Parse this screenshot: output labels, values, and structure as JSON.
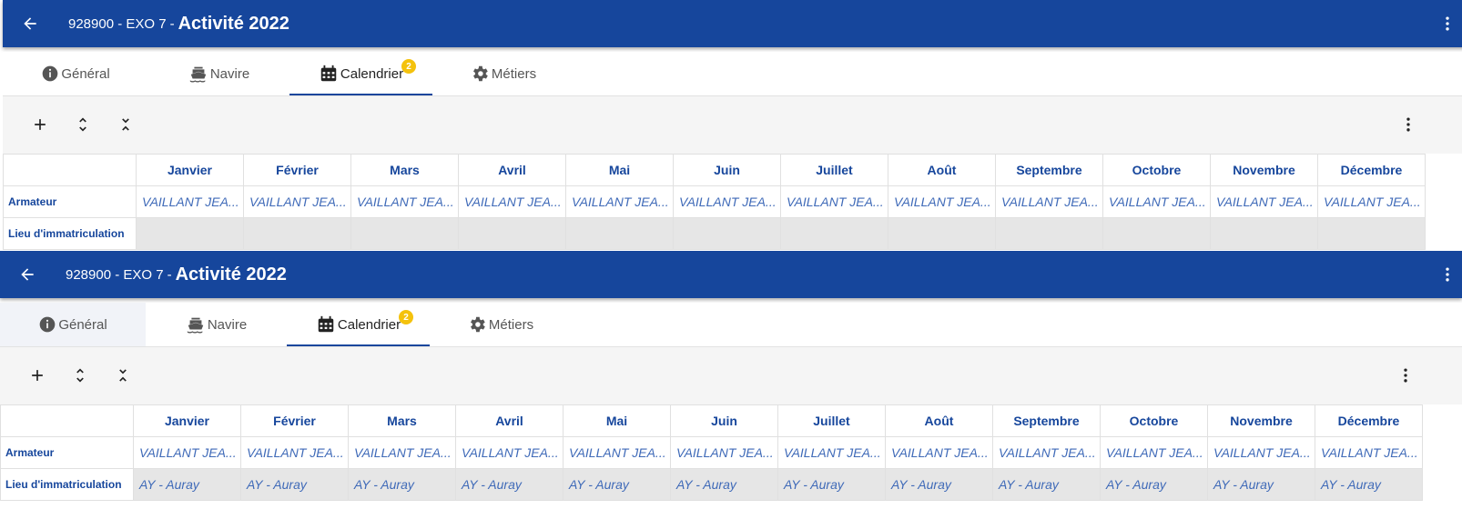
{
  "screens": [
    {
      "header": {
        "code": "928900 - EXO 7",
        "separator": "-",
        "title": "Activité 2022"
      },
      "tabs": [
        {
          "label": "Général"
        },
        {
          "label": "Navire"
        },
        {
          "label": "Calendrier",
          "badge": "2"
        },
        {
          "label": "Métiers"
        }
      ],
      "grid": {
        "months": [
          "Janvier",
          "Février",
          "Mars",
          "Avril",
          "Mai",
          "Juin",
          "Juillet",
          "Août",
          "Septembre",
          "Octobre",
          "Novembre",
          "Décembre"
        ],
        "rows": [
          {
            "label": "Armateur",
            "values": [
              "VAILLANT JEA...",
              "VAILLANT JEA...",
              "VAILLANT JEA...",
              "VAILLANT JEA...",
              "VAILLANT JEA...",
              "VAILLANT JEA...",
              "VAILLANT JEA...",
              "VAILLANT JEA...",
              "VAILLANT JEA...",
              "VAILLANT JEA...",
              "VAILLANT JEA...",
              "VAILLANT JEA..."
            ]
          },
          {
            "label": "Lieu d'immatriculation",
            "values": [
              "",
              "",
              "",
              "",
              "",
              "",
              "",
              "",
              "",
              "",
              "",
              ""
            ]
          }
        ]
      }
    },
    {
      "header": {
        "code": "928900 - EXO 7",
        "separator": "-",
        "title": "Activité 2022"
      },
      "tabs": [
        {
          "label": "Général"
        },
        {
          "label": "Navire"
        },
        {
          "label": "Calendrier",
          "badge": "2"
        },
        {
          "label": "Métiers"
        }
      ],
      "grid": {
        "months": [
          "Janvier",
          "Février",
          "Mars",
          "Avril",
          "Mai",
          "Juin",
          "Juillet",
          "Août",
          "Septembre",
          "Octobre",
          "Novembre",
          "Décembre"
        ],
        "rows": [
          {
            "label": "Armateur",
            "values": [
              "VAILLANT JEA...",
              "VAILLANT JEA...",
              "VAILLANT JEA...",
              "VAILLANT JEA...",
              "VAILLANT JEA...",
              "VAILLANT JEA...",
              "VAILLANT JEA...",
              "VAILLANT JEA...",
              "VAILLANT JEA...",
              "VAILLANT JEA...",
              "VAILLANT JEA...",
              "VAILLANT JEA..."
            ]
          },
          {
            "label": "Lieu d'immatriculation",
            "values": [
              "AY - Auray",
              "AY - Auray",
              "AY - Auray",
              "AY - Auray",
              "AY - Auray",
              "AY - Auray",
              "AY - Auray",
              "AY - Auray",
              "AY - Auray",
              "AY - Auray",
              "AY - Auray",
              "AY - Auray"
            ]
          }
        ]
      }
    }
  ],
  "colors": {
    "primary": "#16469c",
    "badge": "#f4c20d",
    "cell_text": "#3f6ab8",
    "disabled_row": "#e6e6e6"
  },
  "icons": [
    "back-arrow-icon",
    "more-vert-icon",
    "info-icon",
    "ship-icon",
    "calendar-icon",
    "gear-icon",
    "add-icon",
    "expand-icon",
    "collapse-icon"
  ]
}
